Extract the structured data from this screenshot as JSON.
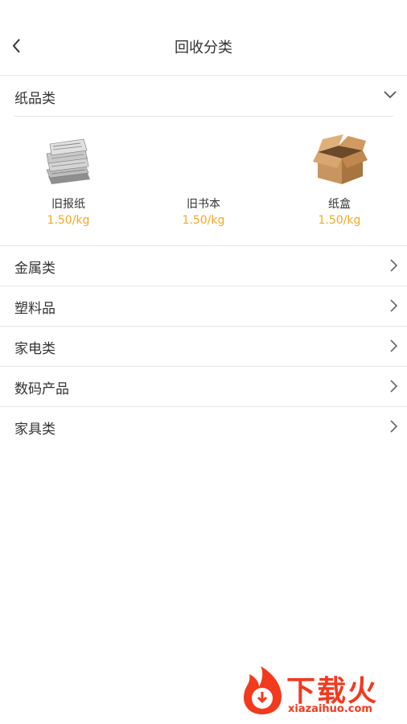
{
  "header": {
    "title": "回收分类"
  },
  "paper_section": {
    "label": "纸品类",
    "items": [
      {
        "name": "旧报纸",
        "price": "1.50/kg"
      },
      {
        "name": "旧书本",
        "price": "1.50/kg"
      },
      {
        "name": "纸盒",
        "price": "1.50/kg"
      }
    ]
  },
  "categories": [
    "金属类",
    "塑料品",
    "家电类",
    "数码产品",
    "家具类"
  ],
  "watermark": {
    "brand": "下载火",
    "domain": "xiazaihuo.com"
  },
  "colors": {
    "price": "#f5a623",
    "divider": "#e6e6e6",
    "brand": "#f23a1e"
  }
}
